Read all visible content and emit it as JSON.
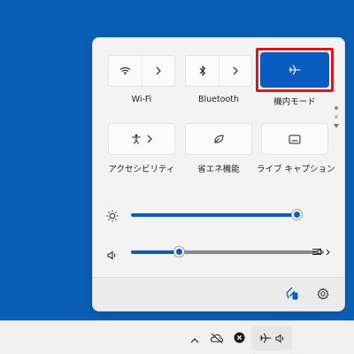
{
  "quick_settings": {
    "tiles": [
      {
        "id": "wifi",
        "label": "Wi-Fi",
        "icon": "wifi-icon",
        "has_chevron": true,
        "active": false
      },
      {
        "id": "bluetooth",
        "label": "Bluetooth",
        "icon": "bluetooth-icon",
        "has_chevron": true,
        "active": false
      },
      {
        "id": "airplane",
        "label": "機内モード",
        "icon": "airplane-icon",
        "has_chevron": false,
        "active": true
      },
      {
        "id": "accessibility",
        "label": "アクセシビリティ",
        "icon": "accessibility-icon",
        "has_chevron": true,
        "active": false
      },
      {
        "id": "energy_saver",
        "label": "省エネ機能",
        "icon": "energy-saver-icon",
        "has_chevron": false,
        "active": false
      },
      {
        "id": "live_captions",
        "label": "ライブ キャプション",
        "icon": "captions-icon",
        "has_chevron": false,
        "active": false
      }
    ],
    "brightness": {
      "icon": "brightness-icon",
      "level_percent": 100
    },
    "volume": {
      "icon": "speaker-icon",
      "level_percent": 25,
      "output_icon": "audio-output-icon"
    },
    "pagination": {
      "total_pages": 2,
      "current_page": 1
    },
    "footer_icons": [
      "battery-saver-icon",
      "settings-icon"
    ]
  },
  "taskbar": {
    "tray_icons": [
      "chevron-up-icon",
      "cloud-offline-icon",
      "close-circle-icon"
    ],
    "group_icons": [
      "airplane-icon",
      "speaker-icon"
    ],
    "clock_time": "",
    "clock_date": ""
  },
  "colors": {
    "accent": "#0b5cc0",
    "desktop": "#0a5fb4",
    "panel": "#f3f3f3",
    "highlight": "#e0141b"
  }
}
